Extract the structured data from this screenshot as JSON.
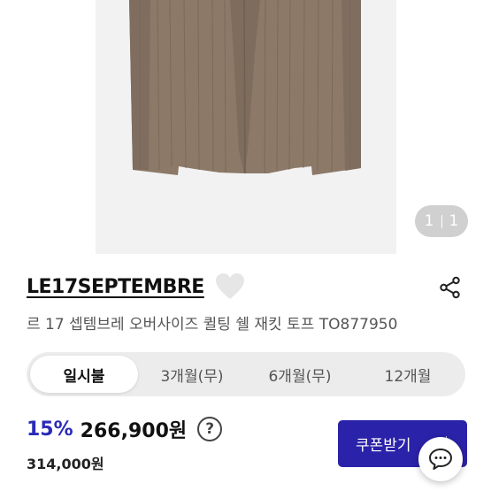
{
  "gallery": {
    "current": "1",
    "total": "1"
  },
  "product": {
    "brand": "LE17SEPTEMBRE",
    "title": "르 17 셉템브레 오버사이즈 퀼팅 쉘 재킷 토프 TO877950",
    "image_icon": "jacket-photo"
  },
  "payment_tabs": [
    {
      "label": "일시불",
      "active": true
    },
    {
      "label": "3개월(무)",
      "active": false
    },
    {
      "label": "6개월(무)",
      "active": false
    },
    {
      "label": "12개월",
      "active": false
    }
  ],
  "price": {
    "discount": "15%",
    "sale": "266,900원",
    "help_symbol": "?",
    "original": "314,000원"
  },
  "coupon": {
    "label": "쿠폰받기"
  },
  "icons": {
    "heart": "heart-icon",
    "share": "share-icon",
    "help": "help-icon",
    "chat": "chat-icon"
  },
  "colors": {
    "accent": "#2a22a8",
    "discount": "#2b2bb8",
    "image_background": "#f2f2f2",
    "jacket": "#8a7766"
  }
}
